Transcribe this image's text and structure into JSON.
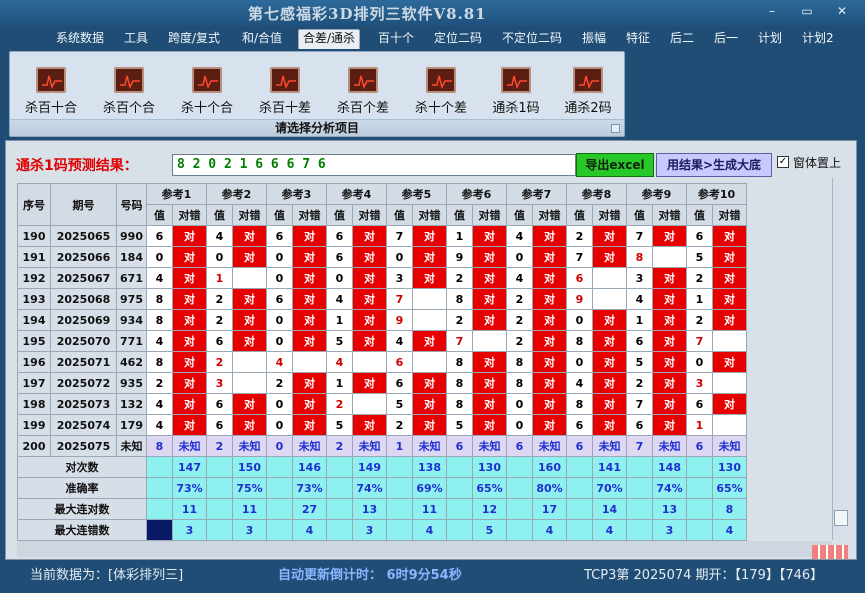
{
  "window": {
    "title": "第七感福彩3D排列三软件V8.81",
    "minimize": "–",
    "restore": "▭",
    "close": "✕"
  },
  "menu": [
    "系统数据",
    "工具",
    "跨度/复式",
    "和/合值",
    "合差/通杀",
    "百十个",
    "定位二码",
    "不定位二码",
    "振幅",
    "特征",
    "后二",
    "后一",
    "计划",
    "计划2"
  ],
  "menu_active": "合差/通杀",
  "ribbon": {
    "buttons": [
      "杀百十合",
      "杀百个合",
      "杀十个合",
      "杀百十差",
      "杀百个差",
      "杀十个差",
      "通杀1码",
      "通杀2码"
    ],
    "footer": "请选择分析项目"
  },
  "prediction": {
    "label": "通杀1码预测结果：",
    "value": "8 2 0 2 1 6 6 6 7 6",
    "export_button": "导出excel",
    "generate_button": "用结果>生成大底",
    "checkbox_checked": true,
    "checkbox_label": "窗体置上"
  },
  "table": {
    "headers": {
      "seq": "序号",
      "period": "期号",
      "number": "号码"
    },
    "refs": [
      "参考1",
      "参考2",
      "参考3",
      "参考4",
      "参考5",
      "参考6",
      "参考7",
      "参考8",
      "参考9",
      "参考10"
    ],
    "sub_value": "值",
    "sub_result": "对错",
    "rows": [
      {
        "seq": "190",
        "period": "2025065",
        "num": "990",
        "vals": [
          "6",
          "4",
          "6",
          "6",
          "7",
          "1",
          "4",
          "2",
          "7",
          "6"
        ],
        "hit": [
          true,
          true,
          true,
          true,
          true,
          true,
          true,
          true,
          true,
          true
        ]
      },
      {
        "seq": "191",
        "period": "2025066",
        "num": "184",
        "vals": [
          "0",
          "0",
          "0",
          "6",
          "0",
          "9",
          "0",
          "7",
          "8",
          "5"
        ],
        "hit": [
          true,
          true,
          true,
          true,
          true,
          true,
          true,
          true,
          false,
          true
        ]
      },
      {
        "seq": "192",
        "period": "2025067",
        "num": "671",
        "vals": [
          "4",
          "1",
          "0",
          "0",
          "3",
          "2",
          "4",
          "6",
          "3",
          "2"
        ],
        "hit": [
          true,
          false,
          true,
          true,
          true,
          true,
          true,
          false,
          true,
          true
        ]
      },
      {
        "seq": "193",
        "period": "2025068",
        "num": "975",
        "vals": [
          "8",
          "2",
          "6",
          "4",
          "7",
          "8",
          "2",
          "9",
          "4",
          "1"
        ],
        "hit": [
          true,
          true,
          true,
          true,
          false,
          true,
          true,
          false,
          true,
          true
        ]
      },
      {
        "seq": "194",
        "period": "2025069",
        "num": "934",
        "vals": [
          "8",
          "2",
          "0",
          "1",
          "9",
          "2",
          "2",
          "0",
          "1",
          "2"
        ],
        "hit": [
          true,
          true,
          true,
          true,
          false,
          true,
          true,
          true,
          true,
          true
        ]
      },
      {
        "seq": "195",
        "period": "2025070",
        "num": "771",
        "vals": [
          "4",
          "6",
          "0",
          "5",
          "4",
          "7",
          "2",
          "8",
          "6",
          "7"
        ],
        "hit": [
          true,
          true,
          true,
          true,
          true,
          false,
          true,
          true,
          true,
          false
        ]
      },
      {
        "seq": "196",
        "period": "2025071",
        "num": "462",
        "vals": [
          "8",
          "2",
          "4",
          "4",
          "6",
          "8",
          "8",
          "0",
          "5",
          "0"
        ],
        "hit": [
          true,
          false,
          false,
          false,
          false,
          true,
          true,
          true,
          true,
          true
        ]
      },
      {
        "seq": "197",
        "period": "2025072",
        "num": "935",
        "vals": [
          "2",
          "3",
          "2",
          "1",
          "6",
          "8",
          "8",
          "4",
          "2",
          "3"
        ],
        "hit": [
          true,
          false,
          true,
          true,
          true,
          true,
          true,
          true,
          true,
          false
        ]
      },
      {
        "seq": "198",
        "period": "2025073",
        "num": "132",
        "vals": [
          "4",
          "6",
          "0",
          "2",
          "5",
          "8",
          "0",
          "8",
          "7",
          "6"
        ],
        "hit": [
          true,
          true,
          true,
          false,
          true,
          true,
          true,
          true,
          true,
          true
        ]
      },
      {
        "seq": "199",
        "period": "2025074",
        "num": "179",
        "vals": [
          "4",
          "6",
          "0",
          "5",
          "2",
          "5",
          "0",
          "6",
          "6",
          "1"
        ],
        "hit": [
          true,
          true,
          true,
          true,
          true,
          true,
          true,
          true,
          true,
          false
        ]
      }
    ],
    "predict_row": {
      "seq": "200",
      "period": "2025075",
      "num": "未知",
      "vals": [
        "8",
        "2",
        "0",
        "2",
        "1",
        "6",
        "6",
        "6",
        "7",
        "6"
      ],
      "result": "未知"
    },
    "marks": {
      "hit": "对",
      "miss": "错"
    },
    "stats": [
      {
        "label": "对次数",
        "values": [
          "147",
          "150",
          "146",
          "149",
          "138",
          "130",
          "160",
          "141",
          "148",
          "130"
        ]
      },
      {
        "label": "准确率",
        "values": [
          "73%",
          "75%",
          "73%",
          "74%",
          "69%",
          "65%",
          "80%",
          "70%",
          "74%",
          "65%"
        ]
      },
      {
        "label": "最大连对数",
        "values": [
          "11",
          "11",
          "27",
          "13",
          "11",
          "12",
          "17",
          "14",
          "13",
          "8"
        ]
      },
      {
        "label": "最大连错数",
        "values": [
          "3",
          "3",
          "4",
          "3",
          "4",
          "5",
          "4",
          "4",
          "3",
          "4"
        ]
      }
    ]
  },
  "status": {
    "current": "当前数据为：[体彩排列三]",
    "countdown": "自动更新倒计时：  6时9分54秒",
    "latest": "TCP3第  2025074 期开：【179】【746】"
  }
}
